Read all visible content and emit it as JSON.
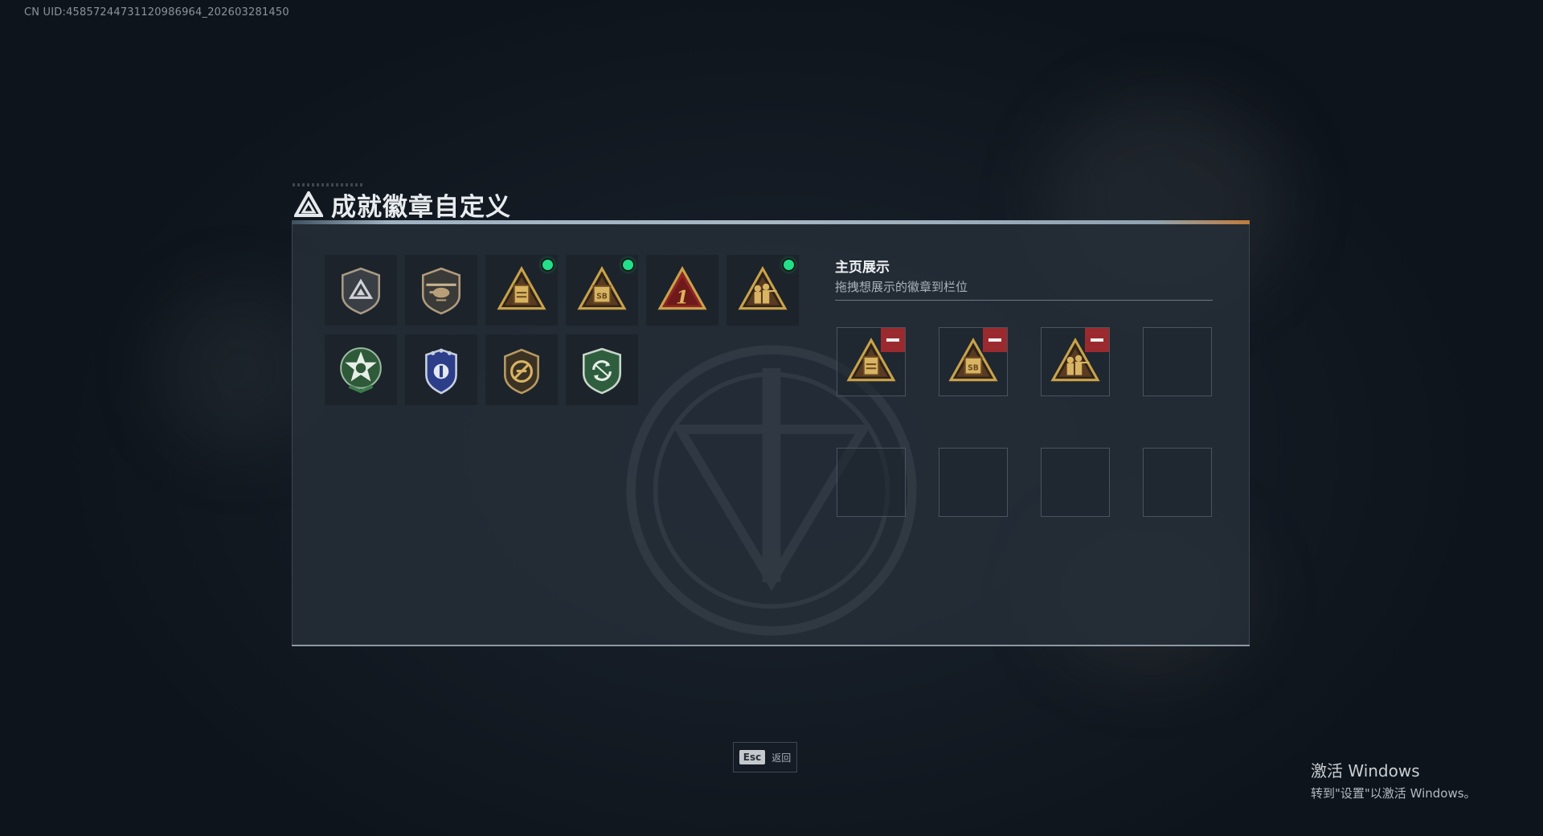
{
  "uid": "CN UID:458572447311209869​64_202603281450",
  "title": "成就徽章自定义",
  "badges": [
    {
      "icon": "shield-triangle-badge-icon",
      "new": false
    },
    {
      "icon": "helicopter-shield-badge-icon",
      "new": false
    },
    {
      "icon": "gold-triangle-crate-badge-icon",
      "new": true
    },
    {
      "icon": "gold-triangle-sb-badge-icon",
      "new": true
    },
    {
      "icon": "red-triangle-number-one-badge-icon",
      "new": false
    },
    {
      "icon": "gold-triangle-soldiers-badge-icon",
      "new": true
    },
    {
      "icon": "green-star-badge-icon",
      "new": false
    },
    {
      "icon": "blue-police-badge-icon",
      "new": false
    },
    {
      "icon": "no-gun-shield-badge-icon",
      "new": false
    },
    {
      "icon": "green-recycle-shield-badge-icon",
      "new": false
    }
  ],
  "showcase": {
    "title": "主页展示",
    "subtitle": "拖拽想展示的徽章到栏位",
    "slots": [
      {
        "badge": "gold-triangle-crate-badge-icon"
      },
      {
        "badge": "gold-triangle-sb-badge-icon"
      },
      {
        "badge": "gold-triangle-soldiers-badge-icon"
      },
      {
        "badge": null
      },
      {
        "badge": null
      },
      {
        "badge": null
      },
      {
        "badge": null
      },
      {
        "badge": null
      }
    ]
  },
  "esc": {
    "key": "Esc",
    "label": "返回"
  },
  "windows_notice": {
    "line1": "激活 Windows",
    "line2": "转到\"设置\"以激活 Windows。"
  },
  "colors": {
    "new_dot": "#22e08a",
    "remove": "#9b2a2f",
    "gold": "#c9a24a",
    "red_badge": "#8f2424"
  }
}
